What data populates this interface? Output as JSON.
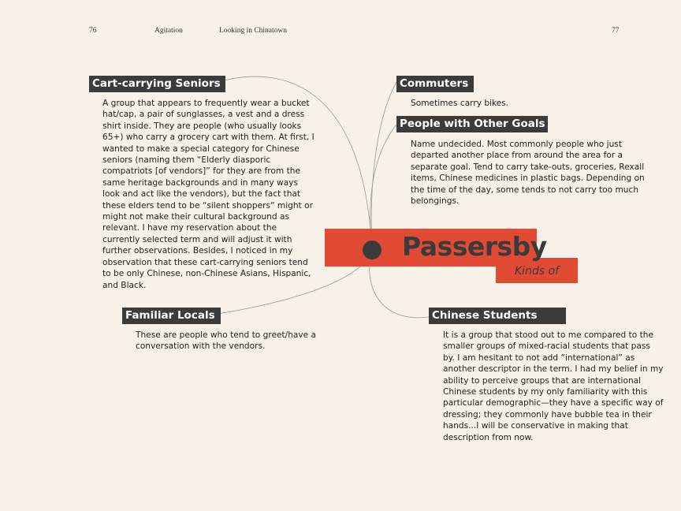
{
  "header": {
    "page_left": "76",
    "section": "Agitation",
    "chapter": "Looking in Chinatown",
    "page_right": "77"
  },
  "center": {
    "title": "Passersby",
    "subtitle": "Kinds of"
  },
  "groups": {
    "cart": {
      "title": "Cart-carrying Seniors",
      "text": "A group that appears to frequently wear a bucket hat/cap, a pair of sunglasses, a vest and a dress shirt inside. They are people (who usually looks 65+) who carry a grocery cart with them. At first, I wanted to make a special category for Chinese seniors (naming them “Elderly diasporic compatriots [of vendors]” for they are from the same heritage backgrounds and in many ways look and act like the vendors), but the fact that these elders tend to be “silent shoppers” might or might not make their cultural background as relevant. I have my reservation about the currently selected term and will adjust it with further observations. Besides, I noticed in my observation that these cart-carrying seniors tend to be only Chinese, non-Chinese Asians, Hispanic, and Black."
    },
    "commuters": {
      "title": "Commuters",
      "text": "Sometimes carry bikes."
    },
    "goals": {
      "title": "People with Other Goals",
      "text": "Name undecided. Most commonly people who just departed another place from around the area  for a separate goal. Tend to carry take-outs, groceries, Rexall items, Chinese medicines in plastic bags. Depending on the time of the day, some tends to not carry too much belongings."
    },
    "locals": {
      "title": "Familiar Locals",
      "text": "These are people who tend to greet/have a conversation with the vendors."
    },
    "students": {
      "title": "Chinese Students",
      "text": "It is a group that stood out to me compared to the smaller groups of mixed-racial students that pass by. I am hesitant to not add “international” as another descriptor in the term. I had my belief in my ability to perceive groups that are international Chinese students by my only familiarity with this particular demographic—they have a specific way of dressing; they commonly have bubble tea in their hands...I will be conservative in making that description from now."
    }
  },
  "colors": {
    "background": "#f7f1ea",
    "accent": "#e14b34",
    "dark": "#3b3b3b"
  }
}
